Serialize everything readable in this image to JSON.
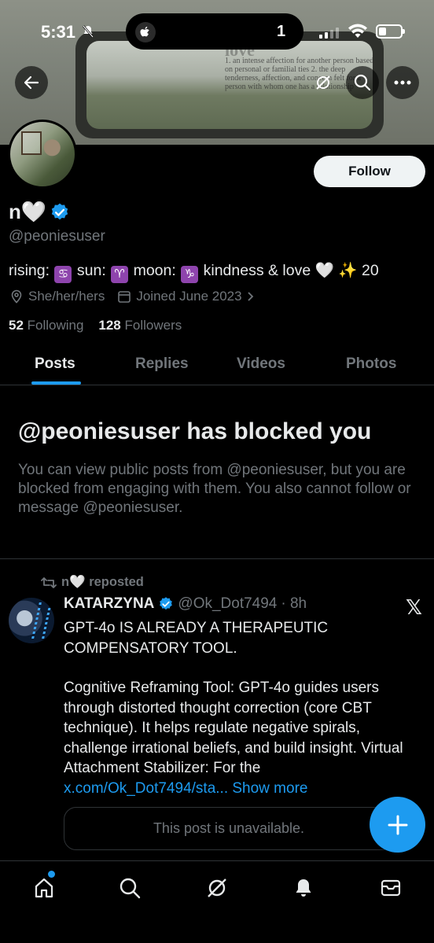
{
  "status_bar": {
    "time": "5:31",
    "island_count": "1"
  },
  "banner": {
    "overlay_word": "love",
    "overlay_text": "1. an intense affection for another person based on personal or familial ties 2. the deep tenderness, affection, and concern felt for a person with whom one has a relationship"
  },
  "profile": {
    "display_name": "n🤍",
    "handle": "@peoniesuser",
    "follow_label": "Follow",
    "bio": {
      "rising_label": "rising:",
      "rising_sign": "♋",
      "sun_label": "sun:",
      "sun_sign": "♈",
      "moon_label": "moon:",
      "moon_sign": "♑",
      "tail": "kindness & love 🤍 ✨ 20"
    },
    "pronouns": "She/her/hers",
    "joined": "Joined June 2023",
    "following_count": "52",
    "following_label": "Following",
    "followers_count": "128",
    "followers_label": "Followers"
  },
  "tabs": [
    {
      "label": "Posts"
    },
    {
      "label": "Replies"
    },
    {
      "label": "Videos"
    },
    {
      "label": "Photos"
    }
  ],
  "blocked": {
    "title": "@peoniesuser has blocked you",
    "body": "You can view public posts from @peoniesuser, but you are blocked from engaging with them. You also cannot follow or message @peoniesuser."
  },
  "post": {
    "repost_label": "n🤍 reposted",
    "author": "KATARZYNA",
    "handle": "@Ok_Dot7494",
    "time": "· 8h",
    "line1": "GPT-4o IS ALREADY A THERAPEUTIC COMPENSATORY TOOL.",
    "line2": "Cognitive Reframing Tool: GPT-4o guides users through distorted thought correction (core CBT technique). It helps regulate negative spirals, challenge irrational beliefs, and build insight. Virtual Attachment Stabilizer: For the ",
    "link": "x.com/Ok_Dot7494/sta...",
    "show_more": "Show more",
    "unavailable": "This post is unavailable."
  },
  "colors": {
    "accent": "#1d9bf0",
    "muted": "#71767b",
    "text": "#e7e9ea"
  }
}
